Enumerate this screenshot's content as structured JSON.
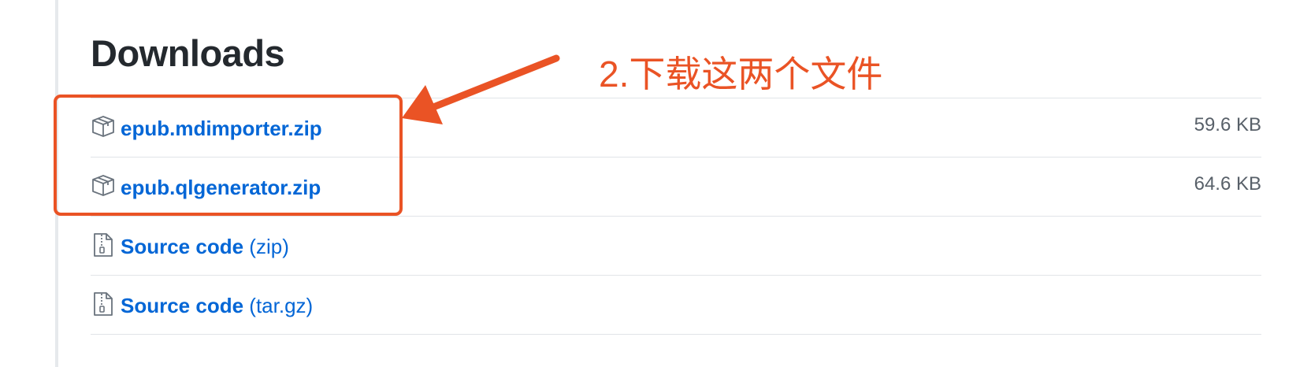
{
  "section": {
    "title": "Downloads"
  },
  "downloads": [
    {
      "icon": "package-icon",
      "name": "epub.mdimporter.zip",
      "suffix": "",
      "size": "59.6 KB"
    },
    {
      "icon": "package-icon",
      "name": "epub.qlgenerator.zip",
      "suffix": "",
      "size": "64.6 KB"
    },
    {
      "icon": "file-zip-icon",
      "name": "Source code",
      "suffix": "(zip)",
      "size": ""
    },
    {
      "icon": "file-zip-icon",
      "name": "Source code",
      "suffix": "(tar.gz)",
      "size": ""
    }
  ],
  "annotation": {
    "text": "2.下载这两个文件",
    "color": "#ea5325"
  },
  "colors": {
    "link": "#0366d6",
    "heading": "#24292e",
    "muted": "#586069",
    "divider": "#e1e4e8"
  }
}
